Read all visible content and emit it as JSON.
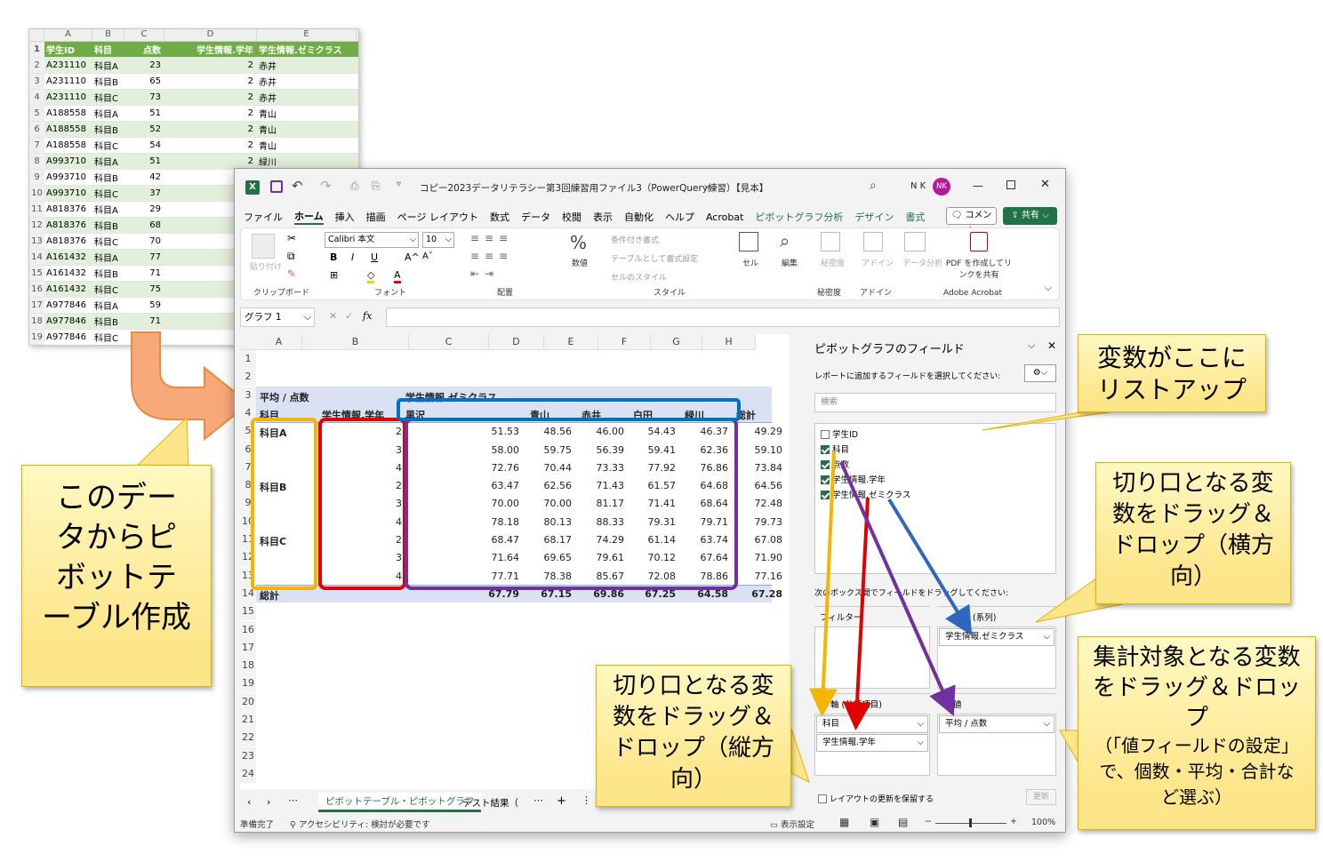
{
  "source_sheet": {
    "columns": [
      "A",
      "B",
      "C",
      "D",
      "E"
    ],
    "headers": [
      "学生ID",
      "科目",
      "点数",
      "学生情報.学年",
      "学生情報.ゼミクラス"
    ],
    "rows": [
      [
        "A231110",
        "科目A",
        "23",
        "2",
        "赤井"
      ],
      [
        "A231110",
        "科目B",
        "65",
        "2",
        "赤井"
      ],
      [
        "A231110",
        "科目C",
        "73",
        "2",
        "赤井"
      ],
      [
        "A188558",
        "科目A",
        "51",
        "2",
        "青山"
      ],
      [
        "A188558",
        "科目B",
        "52",
        "2",
        "青山"
      ],
      [
        "A188558",
        "科目C",
        "54",
        "2",
        "青山"
      ],
      [
        "A993710",
        "科目A",
        "51",
        "2",
        "緑川"
      ],
      [
        "A993710",
        "科目B",
        "42",
        "",
        ""
      ],
      [
        "A993710",
        "科目C",
        "37",
        "",
        ""
      ],
      [
        "A818376",
        "科目A",
        "29",
        "",
        ""
      ],
      [
        "A818376",
        "科目B",
        "68",
        "",
        ""
      ],
      [
        "A818376",
        "科目C",
        "70",
        "",
        ""
      ],
      [
        "A161432",
        "科目A",
        "77",
        "",
        ""
      ],
      [
        "A161432",
        "科目B",
        "71",
        "",
        ""
      ],
      [
        "A161432",
        "科目C",
        "75",
        "",
        ""
      ],
      [
        "A977846",
        "科目A",
        "59",
        "",
        ""
      ],
      [
        "A977846",
        "科目B",
        "71",
        "",
        ""
      ],
      [
        "A977846",
        "科目C",
        "",
        "",
        ""
      ]
    ]
  },
  "window": {
    "title": "コピー2023データリテラシー第3回練習用ファイル3（PowerQuery練習）【見本】",
    "user_initials": "N K",
    "avatar": "NK",
    "tabs": [
      "ファイル",
      "ホーム",
      "挿入",
      "描画",
      "ページ レイアウト",
      "数式",
      "データ",
      "校閲",
      "表示",
      "自動化",
      "ヘルプ",
      "Acrobat",
      "ピボットグラフ分析",
      "デザイン",
      "書式"
    ],
    "comment_btn": "コメント",
    "share_btn": "共有",
    "ribbon": {
      "paste": "貼り付け",
      "clipboard": "クリップボード",
      "font_name": "Calibri 本文",
      "font_size": "10",
      "font": "フォント",
      "alignment": "配置",
      "number_label": "数値",
      "cond_format": "条件付き書式",
      "table_format": "テーブルとして書式設定",
      "cell_style": "セルのスタイル",
      "style": "スタイル",
      "cell": "セル",
      "edit": "編集",
      "sensitivity": "秘密度",
      "sensitivity_btn": "秘密度",
      "addin": "アドイン",
      "addin_btn": "アドイン",
      "data_analysis": "データ分析",
      "pdf": "PDF を作成してリンクを共有",
      "acrobat": "Adobe Acrobat"
    },
    "name_box": "グラフ 1",
    "fx": "fx",
    "col_headers": [
      "A",
      "B",
      "C",
      "D",
      "E",
      "F",
      "G",
      "H"
    ],
    "row_numbers": [
      "1",
      "2",
      "3",
      "4",
      "5",
      "6",
      "7",
      "8",
      "9",
      "10",
      "11",
      "12",
      "13",
      "14",
      "15",
      "16",
      "17",
      "18",
      "19",
      "20",
      "21",
      "22",
      "23",
      "24"
    ],
    "pivot": {
      "title": "平均 / 点数",
      "col_field": "学生情報.ゼミクラス",
      "row_field1": "科目",
      "row_field2": "学生情報.学年",
      "col_labels": [
        "黒沢",
        "青山",
        "赤井",
        "白田",
        "緑川",
        "総計"
      ],
      "groups": [
        {
          "name": "科目A",
          "rows": [
            {
              "year": "2",
              "vals": [
                "51.53",
                "48.56",
                "46.00",
                "54.43",
                "46.37",
                "49.29"
              ]
            },
            {
              "year": "3",
              "vals": [
                "58.00",
                "59.75",
                "56.39",
                "59.41",
                "62.36",
                "59.10"
              ]
            },
            {
              "year": "4",
              "vals": [
                "72.76",
                "70.44",
                "73.33",
                "77.92",
                "76.86",
                "73.84"
              ]
            }
          ]
        },
        {
          "name": "科目B",
          "rows": [
            {
              "year": "2",
              "vals": [
                "63.47",
                "62.56",
                "71.43",
                "61.57",
                "64.68",
                "64.56"
              ]
            },
            {
              "year": "3",
              "vals": [
                "70.00",
                "70.00",
                "81.17",
                "71.41",
                "68.64",
                "72.48"
              ]
            },
            {
              "year": "4",
              "vals": [
                "78.18",
                "80.13",
                "88.33",
                "79.31",
                "79.71",
                "79.73"
              ]
            }
          ]
        },
        {
          "name": "科目C",
          "rows": [
            {
              "year": "2",
              "vals": [
                "68.47",
                "68.17",
                "74.29",
                "61.14",
                "63.74",
                "67.08"
              ]
            },
            {
              "year": "3",
              "vals": [
                "71.64",
                "69.65",
                "79.61",
                "70.12",
                "67.64",
                "71.90"
              ]
            },
            {
              "year": "4",
              "vals": [
                "77.71",
                "78.38",
                "85.67",
                "72.08",
                "78.86",
                "77.16"
              ]
            }
          ]
        }
      ],
      "total_label": "総計",
      "total_vals": [
        "67.79",
        "67.15",
        "69.86",
        "67.25",
        "64.58",
        "67.28"
      ]
    },
    "sheet_tabs": [
      "ピボットテーブル・ピボットグラフ",
      "テスト結果（"
    ],
    "status_ready": "準備完了",
    "status_access": "アクセシビリティ: 検討が必要です",
    "status_display": "表示設定",
    "zoom": "100%",
    "field_pane": {
      "title": "ピボットグラフのフィールド",
      "instruction": "レポートに追加するフィールドを選択してください:",
      "search_placeholder": "検索",
      "fields": [
        {
          "name": "学生ID",
          "checked": false
        },
        {
          "name": "科目",
          "checked": true
        },
        {
          "name": "点数",
          "checked": true
        },
        {
          "name": "学生情報.学年",
          "checked": true
        },
        {
          "name": "学生情報.ゼミクラス",
          "checked": true
        }
      ],
      "drag_hint": "次のボックス間でフィールドをドラッグしてください:",
      "filter_label": "フィルター",
      "legend_label": "凡例 (系列)",
      "legend_item": "学生情報.ゼミクラス",
      "axis_label": "軸 (分類項目)",
      "axis_items": [
        "科目",
        "学生情報.学年"
      ],
      "values_label": "値",
      "values_item": "平均 / 点数",
      "defer_label": "レイアウトの更新を保留する",
      "update_btn": "更新"
    }
  },
  "callouts": {
    "create_pivot": "このデータからピボットテーブル作成",
    "list_up": "変数がここにリストアップ",
    "horizontal": "切り口となる変数をドラッグ＆ドロップ（横方向）",
    "vertical": "切り口となる変数をドラッグ＆ドロップ（縦方向）",
    "aggregate": "集計対象となる変数をドラッグ＆ドロップ",
    "aggregate_note": "（「値フィールドの設定」で、個数・平均・合計など選ぶ）"
  },
  "colors": {
    "excel_green": "#217346",
    "pivot_header": "#d9e1f2",
    "orange": "#f5a700",
    "red": "#e00000",
    "purple": "#7030a0",
    "blue": "#0070c0",
    "callout": "#fde68a"
  }
}
